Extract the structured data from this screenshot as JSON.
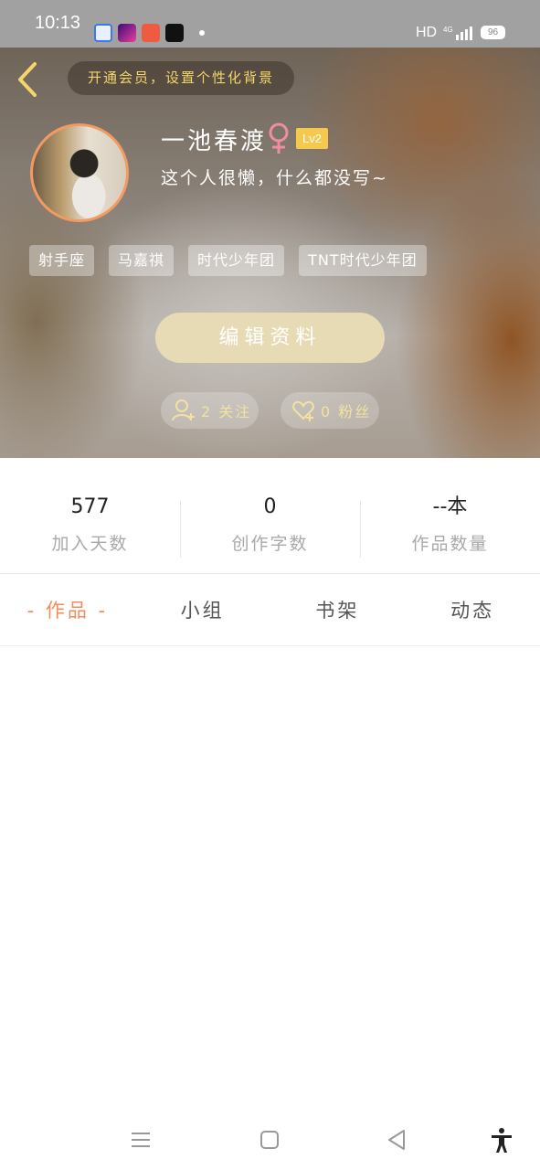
{
  "status_bar": {
    "time": "10:13",
    "network": "HD",
    "battery": "96"
  },
  "header": {
    "vip_prompt": "开通会员，设置个性化背景",
    "username": "一池春渡",
    "level": "Lv2",
    "bio": "这个人很懒，什么都没写~",
    "tags": [
      "射手座",
      "马嘉祺",
      "时代少年团",
      "TNT时代少年团"
    ],
    "edit_button": "编辑资料",
    "follow_label": "2 关注",
    "fans_label": "0 粉丝",
    "accent_color": "#f2d66a"
  },
  "stats": [
    {
      "value": "577",
      "label": "加入天数"
    },
    {
      "value": "0",
      "label": "创作字数"
    },
    {
      "value": "--本",
      "label": "作品数量"
    }
  ],
  "tabs": [
    {
      "label": "- 作品 -",
      "active": true
    },
    {
      "label": "小组",
      "active": false
    },
    {
      "label": "书架",
      "active": false
    },
    {
      "label": "动态",
      "active": false
    }
  ],
  "colors": {
    "active_tab": "#f28d5a",
    "avatar_border": "#f39a63",
    "edit_button_bg": "#e7dbb5"
  }
}
